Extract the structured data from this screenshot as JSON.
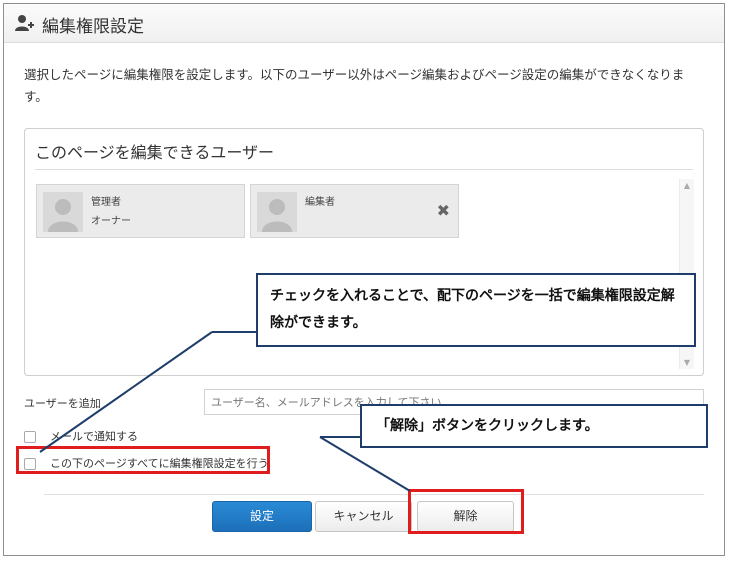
{
  "dialog": {
    "title": "編集権限設定",
    "description": "選択したページに編集権限を設定します。以下のユーザー以外はページ編集およびページ設定の編集ができなくなります。"
  },
  "panel": {
    "title": "このページを編集できるユーザー",
    "users": [
      {
        "line1": "管理者",
        "line2": "オーナー"
      },
      {
        "line1": "編集者",
        "line2": ""
      }
    ]
  },
  "add_user": {
    "label": "ユーザーを追加",
    "placeholder": "ユーザー名、メールアドレスを入力して下さい"
  },
  "options": {
    "notify_mail": "メールで通知する",
    "apply_children": "この下のページすべてに編集権限設定を行う"
  },
  "buttons": {
    "save": "設定",
    "cancel": "キャンセル",
    "release": "解除"
  },
  "annotations": {
    "callout_checkbox": "チェックを入れることで、配下のページを一括で編集権限設定解除ができます。",
    "callout_button": "「解除」ボタンをクリックします。"
  },
  "colors": {
    "primary_button": "#1d6fb8",
    "highlight_red": "#e01c1c",
    "callout_border": "#1f3d6a"
  }
}
